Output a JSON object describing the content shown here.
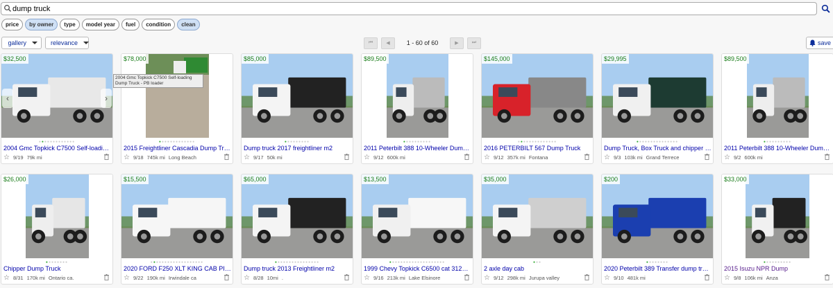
{
  "search": {
    "query": "dump truck",
    "icon": "search-icon"
  },
  "filters": [
    {
      "label": "price",
      "active": false
    },
    {
      "label": "by owner",
      "active": true
    },
    {
      "label": "type",
      "active": false
    },
    {
      "label": "model year",
      "active": false
    },
    {
      "label": "fuel",
      "active": false
    },
    {
      "label": "condition",
      "active": false
    },
    {
      "label": "clean",
      "active": true
    }
  ],
  "toolbar": {
    "view_label": "gallery",
    "sort_label": "relevance",
    "page_count": "1 - 60 of 60",
    "save_label": "save"
  },
  "tooltip": "2004 Gmc Topkick C7500 Self-loading Dump Truck - PB loader",
  "listings": [
    {
      "price": "$32,500",
      "title": "2004 Gmc Topkick C7500 Self-loading ...",
      "date": "9/19",
      "miles": "79k mi",
      "location": "",
      "dots": 13,
      "active_dot": 2
    },
    {
      "price": "$78,000",
      "title": "2015 Freightliner Cascadia Dump Truck",
      "date": "9/18",
      "miles": "745k mi",
      "location": "Long Beach",
      "dots": 13,
      "active_dot": 1
    },
    {
      "price": "$85,000",
      "title": "Dump truck 2017 freightliner m2",
      "date": "9/17",
      "miles": "50k mi",
      "location": "",
      "dots": 9,
      "active_dot": 1
    },
    {
      "price": "$89,500",
      "title": "2011 Peterbilt 388 10-Wheeler Dump Tr...",
      "date": "9/12",
      "miles": "600k mi",
      "location": "",
      "dots": 10,
      "active_dot": 1
    },
    {
      "price": "$145,000",
      "title": "2016 PETERBILT 567 Dump Truck",
      "date": "9/12",
      "miles": "357k mi",
      "location": "Fontana",
      "dots": 14,
      "active_dot": 2
    },
    {
      "price": "$29,995",
      "title": "Dump Truck, Box Truck and chipper truck",
      "date": "9/3",
      "miles": "103k mi",
      "location": "Grand Terrece",
      "dots": 15,
      "active_dot": 1
    },
    {
      "price": "$89,500",
      "title": "2011 Peterbilt 388 10-Wheeler Dump Tr...",
      "date": "9/2",
      "miles": "600k mi",
      "location": "",
      "dots": 10,
      "active_dot": 1
    },
    {
      "price": "$26,000",
      "title": "Chipper Dump Truck",
      "date": "8/31",
      "miles": "170k mi",
      "location": "Ontario ca.",
      "dots": 8,
      "active_dot": 1
    },
    {
      "price": "$15,500",
      "title": "2020 FORD F250 XLT KING CAB PICK...",
      "date": "9/22",
      "miles": "190k mi",
      "location": "Irwindale ca",
      "dots": 19,
      "active_dot": 2
    },
    {
      "price": "$65,000",
      "title": "Dump truck 2013 Freightliner m2",
      "date": "8/28",
      "miles": "10mi",
      "location": ".",
      "dots": 16,
      "active_dot": 1
    },
    {
      "price": "$13,500",
      "title": "1999 Chevy Topkick C6500 cat 3126 sn...",
      "date": "9/16",
      "miles": "213k mi",
      "location": "Lake Elsinore",
      "dots": 20,
      "active_dot": 1
    },
    {
      "price": "$35,000",
      "title": "2 axle day cab",
      "date": "9/12",
      "miles": "298k mi",
      "location": "Jurupa valley",
      "dots": 3,
      "active_dot": 1
    },
    {
      "price": "$200",
      "title": "2020 Peterbilt 389 Transfer dump truck",
      "date": "9/10",
      "miles": "481k mi",
      "location": "",
      "dots": 8,
      "active_dot": 1
    },
    {
      "price": "$33,000",
      "title": "2015 Isuzu NPR Dump",
      "date": "9/8",
      "miles": "106k mi",
      "location": "Anza",
      "dots": 10,
      "active_dot": 1
    }
  ],
  "colors": {
    "price": "#1a7d1a",
    "link": "#0000aa",
    "pill_active": "#cfe0f5"
  }
}
